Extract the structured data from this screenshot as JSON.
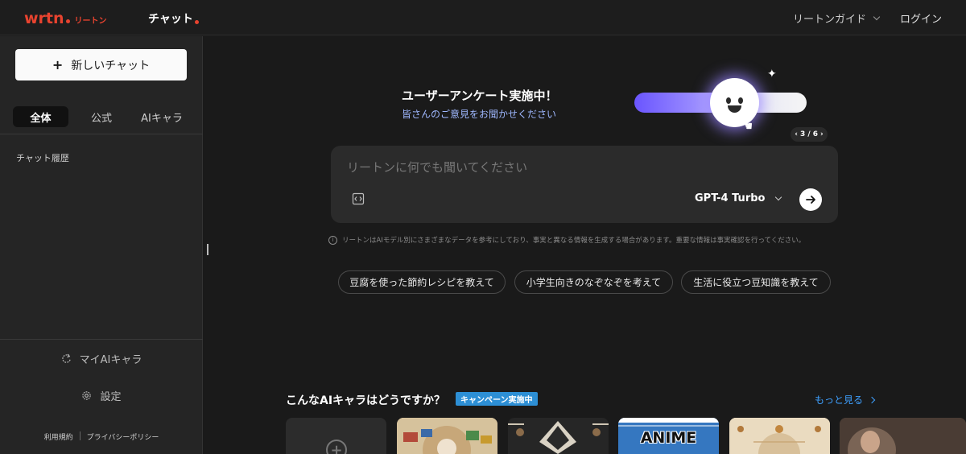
{
  "topbar": {
    "logo_text": "wrtn",
    "logo_sub": "リートン",
    "nav_chat": "チャット",
    "guide_label": "リートンガイド",
    "login_label": "ログイン"
  },
  "sidebar": {
    "new_chat_label": "新しいチャット",
    "tabs": [
      {
        "label": "全体",
        "active": true
      },
      {
        "label": "公式",
        "active": false
      },
      {
        "label": "AIキャラ",
        "active": false
      }
    ],
    "history_label": "チャット履歴",
    "my_ai_label": "マイAIキャラ",
    "settings_label": "設定",
    "terms_label": "利用規約",
    "privacy_label": "プライバシーポリシー"
  },
  "banner": {
    "title": "ユーザーアンケート実施中！",
    "subtitle": "皆さんのご意見をお聞かせください",
    "pager": "3 / 6"
  },
  "prompt": {
    "placeholder": "リートンに何でも聞いてください",
    "model": "GPT-4 Turbo"
  },
  "disclaimer": "リートンはAIモデル別にさまざまなデータを参考にしており、事実と異なる情報を生成する場合があります。重要な情報は事実確認を行ってください。",
  "suggestions": [
    "豆腐を使った節約レシピを教えて",
    "小学生向きのなぞなぞを考えて",
    "生活に役立つ豆知識を教えて"
  ],
  "characters": {
    "title": "こんなAIキャラはどうですか？",
    "badge": "キャンペーン実施中",
    "more_label": "もっと見る",
    "card_anime_text": "ANIME"
  },
  "colors": {
    "brand": "#e8432f",
    "link": "#3ea0ff",
    "badge": "#2d8fd5"
  }
}
